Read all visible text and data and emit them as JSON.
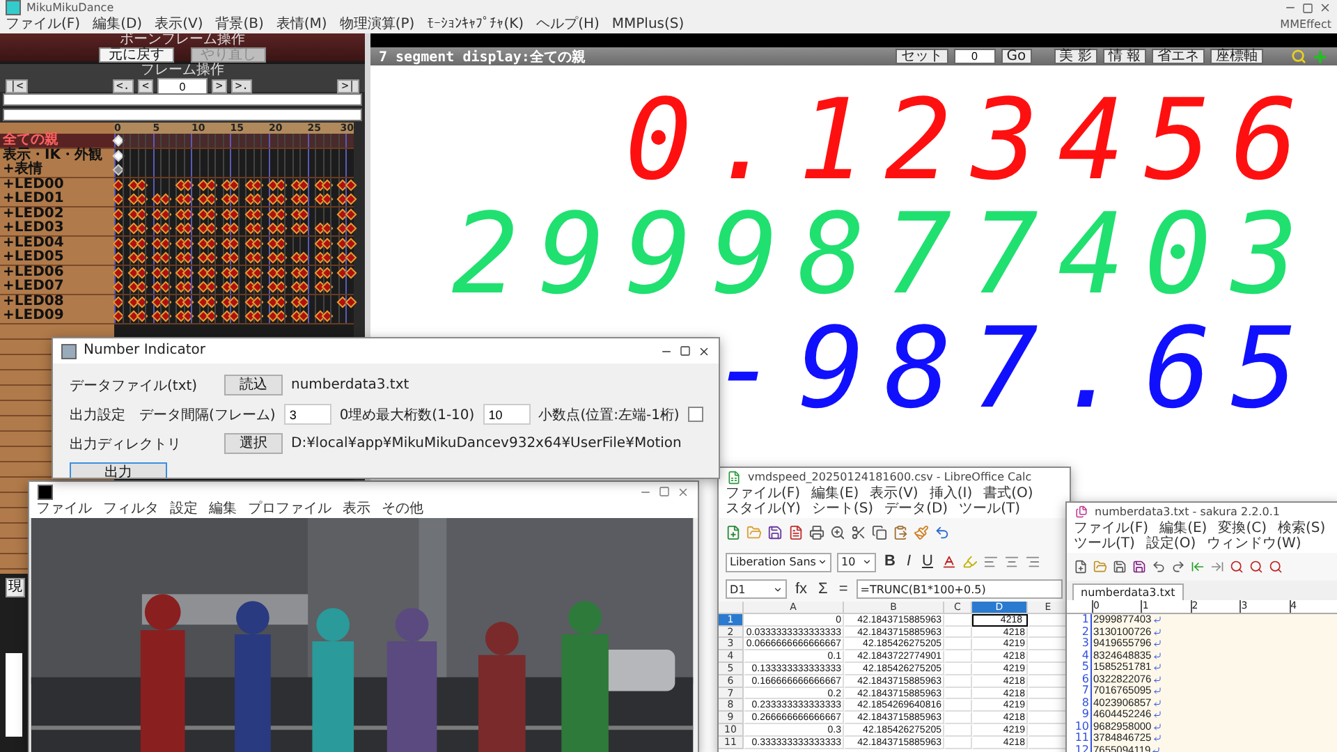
{
  "mmd": {
    "title": "MikuMikuDance",
    "menu": [
      "ファイル(F)",
      "編集(D)",
      "表示(V)",
      "背景(B)",
      "表情(M)",
      "物理演算(P)",
      "ﾓｰｼｮﾝｷｬﾌﾟﾁｬ(K)",
      "ヘルプ(H)",
      "MMPlus(S)"
    ],
    "effect_label": "MMEffect",
    "bone_panel": {
      "title": "ボーンフレーム操作",
      "buttons": [
        {
          "label": "元に戻す",
          "disabled": false
        },
        {
          "label": "やり直し",
          "disabled": true
        }
      ]
    },
    "frame_panel": {
      "title": "フレーム操作",
      "nav_left": [
        "|<",
        "<.",
        "<"
      ],
      "frame": "0",
      "nav_right": [
        ">",
        ">.",
        ">|"
      ]
    },
    "timeline": {
      "ticks": [
        "0",
        "5",
        "10",
        "15",
        "20",
        "25",
        "30"
      ],
      "rows": [
        {
          "name": "全ての親",
          "kind": "bone",
          "selected": true,
          "keyframes": [
            true,
            false,
            false,
            false,
            false,
            false,
            false,
            false,
            false,
            false,
            false,
            false,
            false,
            false,
            false,
            false,
            false,
            false,
            false,
            false,
            false,
            false,
            false,
            false,
            false,
            false,
            false,
            false,
            false,
            false,
            false
          ]
        },
        {
          "name": "表示・IK・外観",
          "kind": "bone",
          "selected": false,
          "keyframes": [
            true,
            false,
            false,
            false,
            false,
            false,
            false,
            false,
            false,
            false,
            false,
            false,
            false,
            false,
            false,
            false,
            false,
            false,
            false,
            false,
            false,
            false,
            false,
            false,
            false,
            false,
            false,
            false,
            false,
            false,
            false
          ]
        },
        {
          "name": "+表情",
          "kind": "morph",
          "selected": false,
          "keyframes": [
            true,
            false,
            false,
            false,
            false,
            false,
            false,
            false,
            false,
            false,
            false,
            false,
            false,
            false,
            false,
            false,
            false,
            false,
            false,
            false,
            false,
            false,
            false,
            false,
            false,
            false,
            false,
            false,
            false,
            false,
            false
          ]
        },
        {
          "name": "+LED00",
          "kind": "group",
          "selected": false,
          "keyframes": [
            true,
            false,
            true,
            true,
            false,
            false,
            false,
            false,
            true,
            true,
            false,
            true,
            true,
            false,
            true,
            true,
            false,
            true,
            true,
            false,
            true,
            true,
            false,
            true,
            true,
            false,
            true,
            true,
            false,
            true,
            true
          ]
        },
        {
          "name": "+LED01",
          "kind": "group",
          "selected": false,
          "keyframes": [
            true,
            false,
            true,
            true,
            false,
            true,
            true,
            false,
            true,
            true,
            false,
            true,
            true,
            false,
            true,
            true,
            false,
            true,
            true,
            false,
            true,
            true,
            false,
            true,
            true,
            false,
            true,
            true,
            false,
            true,
            true
          ]
        },
        {
          "name": "+LED02",
          "kind": "group",
          "selected": false,
          "keyframes": [
            true,
            false,
            true,
            true,
            false,
            true,
            true,
            false,
            true,
            true,
            false,
            true,
            true,
            false,
            true,
            true,
            false,
            true,
            true,
            false,
            true,
            true,
            false,
            true,
            true,
            false,
            false,
            false,
            false,
            true,
            true
          ]
        },
        {
          "name": "+LED03",
          "kind": "group",
          "selected": false,
          "keyframes": [
            true,
            false,
            true,
            true,
            false,
            true,
            true,
            false,
            true,
            true,
            false,
            true,
            true,
            false,
            true,
            true,
            false,
            true,
            true,
            false,
            true,
            true,
            false,
            true,
            true,
            false,
            true,
            true,
            false,
            true,
            true
          ]
        },
        {
          "name": "+LED04",
          "kind": "group",
          "selected": false,
          "keyframes": [
            true,
            false,
            true,
            true,
            false,
            true,
            true,
            false,
            true,
            true,
            false,
            true,
            true,
            false,
            true,
            true,
            false,
            true,
            true,
            false,
            true,
            true,
            false,
            false,
            false,
            false,
            true,
            true,
            false,
            true,
            true
          ]
        },
        {
          "name": "+LED05",
          "kind": "group",
          "selected": false,
          "keyframes": [
            true,
            false,
            true,
            true,
            false,
            true,
            true,
            false,
            true,
            true,
            false,
            true,
            true,
            false,
            true,
            true,
            false,
            true,
            true,
            false,
            true,
            true,
            false,
            true,
            true,
            false,
            true,
            true,
            false,
            true,
            true
          ]
        },
        {
          "name": "+LED06",
          "kind": "group",
          "selected": false,
          "keyframes": [
            true,
            false,
            true,
            true,
            false,
            true,
            true,
            false,
            true,
            true,
            false,
            true,
            true,
            false,
            true,
            true,
            false,
            true,
            true,
            false,
            true,
            true,
            false,
            true,
            true,
            false,
            true,
            true,
            false,
            true,
            true
          ]
        },
        {
          "name": "+LED07",
          "kind": "group",
          "selected": false,
          "keyframes": [
            true,
            false,
            true,
            true,
            false,
            true,
            true,
            false,
            true,
            true,
            false,
            true,
            true,
            false,
            true,
            true,
            false,
            true,
            true,
            false,
            true,
            true,
            false,
            true,
            true,
            false,
            true,
            true,
            false,
            false,
            false
          ]
        },
        {
          "name": "+LED08",
          "kind": "group",
          "selected": false,
          "keyframes": [
            true,
            false,
            true,
            true,
            false,
            true,
            true,
            false,
            true,
            true,
            false,
            true,
            true,
            false,
            true,
            true,
            false,
            true,
            true,
            false,
            true,
            true,
            false,
            true,
            true,
            false,
            false,
            false,
            false,
            true,
            true
          ]
        },
        {
          "name": "+LED09",
          "kind": "group",
          "selected": false,
          "keyframes": [
            true,
            false,
            true,
            true,
            false,
            true,
            true,
            false,
            true,
            true,
            false,
            true,
            true,
            false,
            true,
            true,
            false,
            true,
            true,
            false,
            true,
            true,
            false,
            true,
            true,
            false,
            true,
            true,
            false,
            false,
            false
          ]
        }
      ]
    },
    "current_button": "現"
  },
  "viewport": {
    "title": "7 segment display:全ての親",
    "set_button": "セット",
    "frame": "0",
    "go_button": "Go",
    "tools": [
      "美 影",
      "情 報",
      "省エネ",
      "座標軸"
    ],
    "displays": [
      {
        "text": "0.123456",
        "color": "#ff1010"
      },
      {
        "text": "2999877403",
        "color": "#20e070"
      },
      {
        "text": "-987.65",
        "color": "#1010ff"
      }
    ]
  },
  "number_indicator": {
    "title": "Number Indicator",
    "data_file": {
      "label": "データファイル(txt)",
      "button": "読込",
      "value": "numberdata3.txt"
    },
    "output": {
      "label": "出力設定",
      "interval_label": "データ間隔(フレーム)",
      "interval": "3",
      "digits_label": "0埋め最大桁数(1-10)",
      "digits": "10",
      "decimal_label": "小数点(位置:左端-1桁)",
      "decimal_checked": false
    },
    "directory": {
      "label": "出力ディレクトリ",
      "button": "選択",
      "value": "D:¥local¥app¥MikuMikuDancev932x64¥UserFile¥Motion"
    },
    "run_button": "出力"
  },
  "video_viewer": {
    "menu": [
      "ファイル",
      "フィルタ",
      "設定",
      "編集",
      "プロファイル",
      "表示",
      "その他"
    ]
  },
  "calc": {
    "title": "vmdspeed_20250124181600.csv - LibreOffice Calc",
    "menu": [
      "ファイル(F)",
      "編集(E)",
      "表示(V)",
      "挿入(I)",
      "書式(O)",
      "スタイル(Y)",
      "シート(S)",
      "データ(D)",
      "ツール(T)"
    ],
    "font": "Liberation Sans",
    "size": "10",
    "format_buttons": [
      "B",
      "I",
      "U"
    ],
    "cell_ref": "D1",
    "formula_buttons": [
      "fx",
      "Σ",
      "="
    ],
    "formula": "=TRUNC(B1*100+0.5)",
    "columns": [
      {
        "label": "A",
        "selected": false
      },
      {
        "label": "B",
        "selected": false
      },
      {
        "label": "C",
        "selected": false
      },
      {
        "label": "D",
        "selected": true
      },
      {
        "label": "E",
        "selected": false
      }
    ],
    "rows": [
      {
        "label": "1",
        "selected": true,
        "a": "0",
        "b": "42.1843715885963",
        "d": "4218"
      },
      {
        "label": "2",
        "selected": false,
        "a": "0.0333333333333333",
        "b": "42.1843715885963",
        "d": "4218"
      },
      {
        "label": "3",
        "selected": false,
        "a": "0.0666666666666667",
        "b": "42.185426275205",
        "d": "4219"
      },
      {
        "label": "4",
        "selected": false,
        "a": "0.1",
        "b": "42.1843722774901",
        "d": "4218"
      },
      {
        "label": "5",
        "selected": false,
        "a": "0.133333333333333",
        "b": "42.185426275205",
        "d": "4219"
      },
      {
        "label": "6",
        "selected": false,
        "a": "0.166666666666667",
        "b": "42.1843715885963",
        "d": "4218"
      },
      {
        "label": "7",
        "selected": false,
        "a": "0.2",
        "b": "42.1843715885963",
        "d": "4218"
      },
      {
        "label": "8",
        "selected": false,
        "a": "0.233333333333333",
        "b": "42.1854269640816",
        "d": "4219"
      },
      {
        "label": "9",
        "selected": false,
        "a": "0.266666666666667",
        "b": "42.1843715885963",
        "d": "4218"
      },
      {
        "label": "10",
        "selected": false,
        "a": "0.3",
        "b": "42.185426275205",
        "d": "4219"
      },
      {
        "label": "11",
        "selected": false,
        "a": "0.333333333333333",
        "b": "42.1843715885963",
        "d": "4218"
      }
    ]
  },
  "sakura": {
    "title": "numberdata3.txt - sakura 2.2.0.1",
    "menu": [
      "ファイル(F)",
      "編集(E)",
      "変換(C)",
      "検索(S)",
      "ツール(T)",
      "設定(O)",
      "ウィンドウ(W)"
    ],
    "tabs": [
      {
        "label": "numberdata3.txt",
        "selected": true
      }
    ],
    "ruler": [
      "0",
      "1",
      "2",
      "3",
      "4"
    ],
    "lines": [
      {
        "number": "1",
        "text": "2999877403"
      },
      {
        "number": "2",
        "text": "3130100726"
      },
      {
        "number": "3",
        "text": "9419655796"
      },
      {
        "number": "4",
        "text": "8324648835"
      },
      {
        "number": "5",
        "text": "1585251781"
      },
      {
        "number": "6",
        "text": "0322822076"
      },
      {
        "number": "7",
        "text": "7016765095"
      },
      {
        "number": "8",
        "text": "4023906857"
      },
      {
        "number": "9",
        "text": "4604452246"
      },
      {
        "number": "10",
        "text": "9682958000"
      },
      {
        "number": "11",
        "text": "3784846725"
      },
      {
        "number": "12",
        "text": "7655094119"
      }
    ]
  }
}
